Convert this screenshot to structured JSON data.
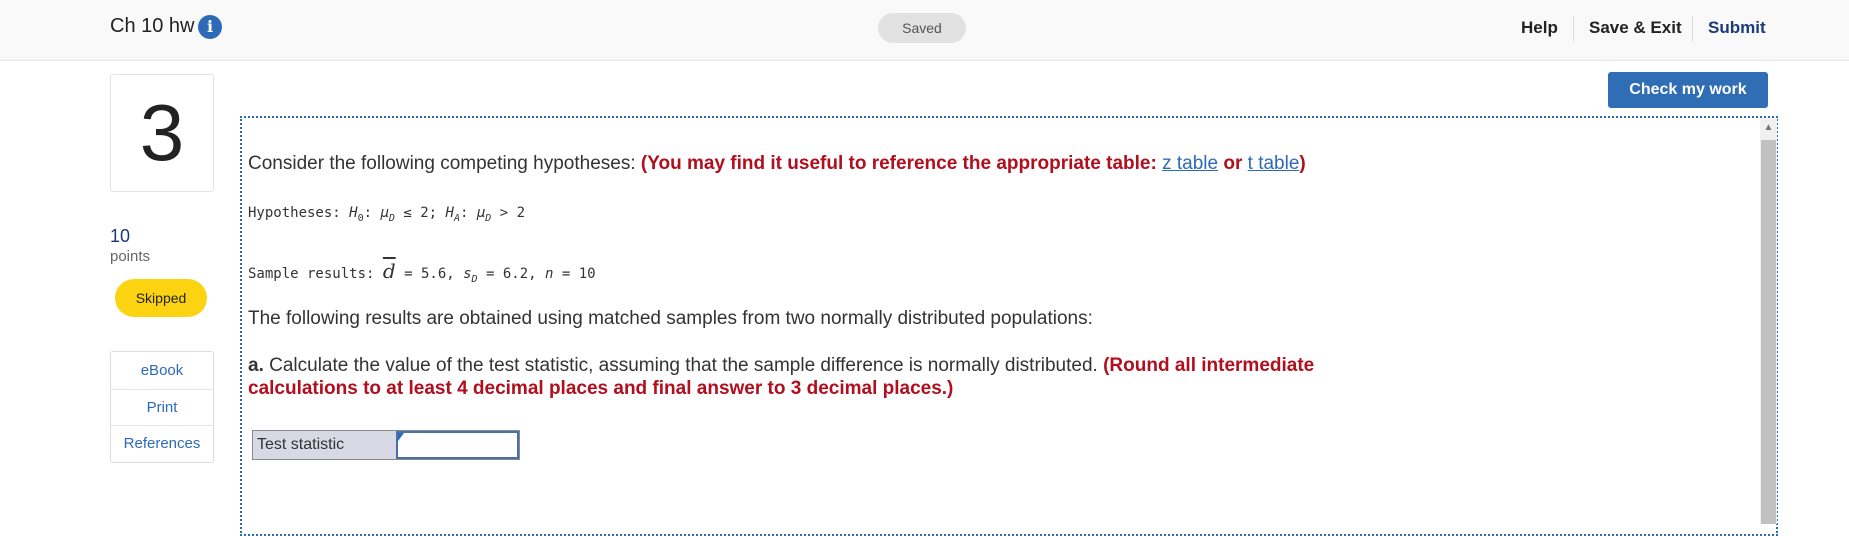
{
  "header": {
    "title": "Ch 10 hw",
    "info_icon": "info-icon",
    "status": "Saved",
    "nav": {
      "help": "Help",
      "save_exit": "Save & Exit",
      "submit": "Submit"
    }
  },
  "sidebar": {
    "question_number": "3",
    "points_value": "10",
    "points_label": "points",
    "status_badge": "Skipped",
    "links": [
      "eBook",
      "Print",
      "References"
    ]
  },
  "toolbar": {
    "check_button": "Check my work"
  },
  "question": {
    "intro": "Consider the following competing hypotheses: ",
    "reference_note_prefix": "(You may find it useful to reference the appropriate table: ",
    "z_table": "z table",
    "or": " or ",
    "t_table": "t table",
    "reference_note_suffix": ")",
    "hypotheses_label": "Hypotheses: ",
    "h0_label": "H",
    "h0_sub": "0",
    "h0_cond_mu": "μ",
    "h0_cond_sub": "D",
    "h0_cond_rest": " ≤ 2; ",
    "ha_label": "H",
    "ha_sub": "A",
    "ha_cond_mu": "μ",
    "ha_cond_sub": "D",
    "ha_cond_rest": " > 2",
    "sample_label": "Sample results: ",
    "dbar_symbol": "d",
    "dbar_value": " = 5.6, ",
    "sd_symbol": "s",
    "sd_sub": "D",
    "sd_value": " = 6.2, ",
    "n_symbol": "n",
    "n_value": " = 10",
    "results_text": "The following results are obtained using matched samples from two normally distributed populations:",
    "part_a_label": "a.",
    "part_a_text": " Calculate the value of the test statistic, assuming that the sample difference is normally distributed. ",
    "part_a_note": "(Round all intermediate calculations to at least 4 decimal places and final answer to 3 decimal places.)"
  },
  "answer_table": {
    "label": "Test statistic",
    "value": ""
  },
  "colors": {
    "accent": "#2f6db5",
    "warning": "#b10e1e",
    "badge": "#fcd310"
  }
}
